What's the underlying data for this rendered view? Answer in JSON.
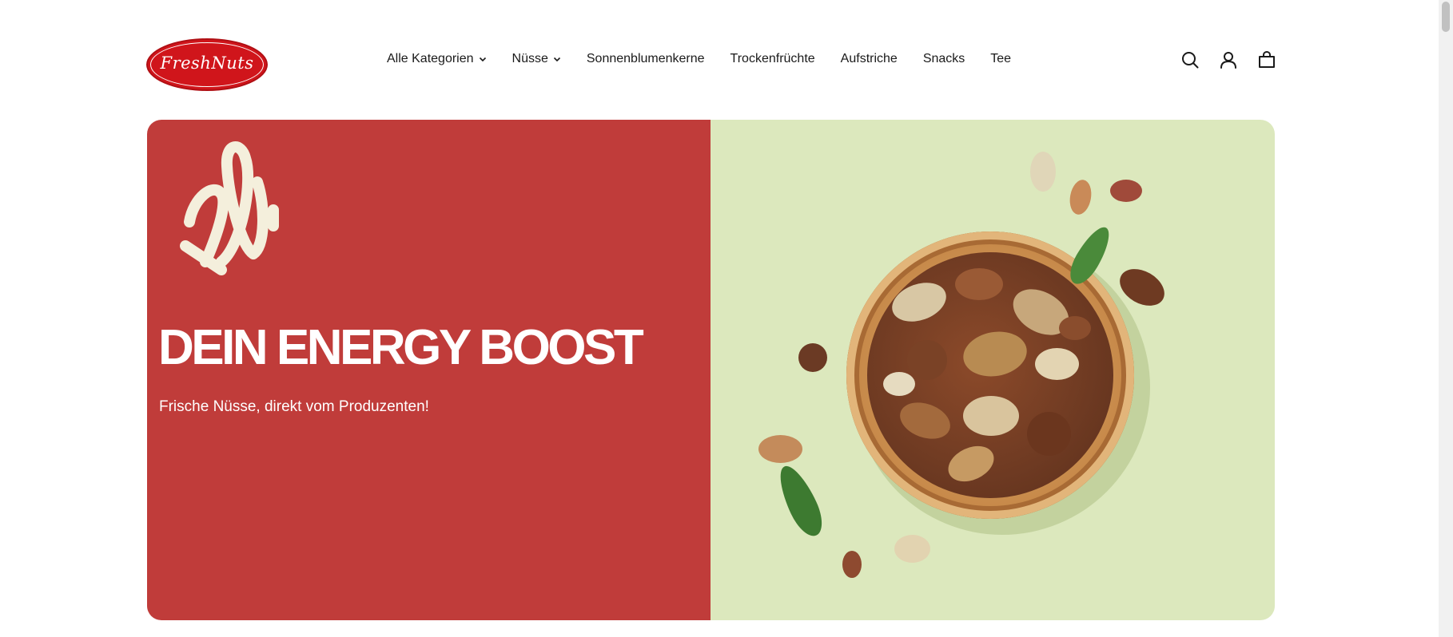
{
  "header": {
    "logo_text": "FreshNuts",
    "nav": [
      {
        "label": "Alle Kategorien",
        "dropdown": true
      },
      {
        "label": "Nüsse",
        "dropdown": true
      },
      {
        "label": "Sonnenblumenkerne",
        "dropdown": false
      },
      {
        "label": "Trockenfrüchte",
        "dropdown": false
      },
      {
        "label": "Aufstriche",
        "dropdown": false
      },
      {
        "label": "Snacks",
        "dropdown": false
      },
      {
        "label": "Tee",
        "dropdown": false
      }
    ],
    "icons": [
      "search-icon",
      "account-icon",
      "cart-icon"
    ]
  },
  "hero": {
    "title": "DEIN ENERGY BOOST",
    "subtitle": "Frische Nüsse, direkt vom Produzenten!",
    "left_color": "#c03c3a",
    "right_color": "#dce8bd"
  },
  "colors": {
    "brand_red": "#d0151b",
    "text": "#1a1a1a"
  }
}
